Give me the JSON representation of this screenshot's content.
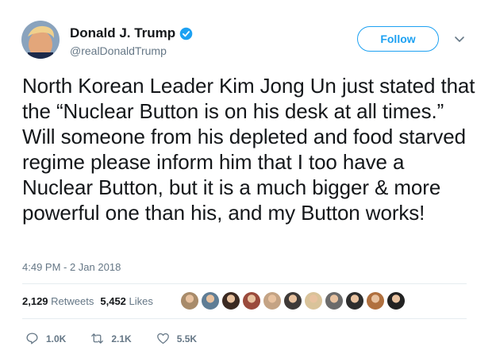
{
  "author": {
    "display_name": "Donald J. Trump",
    "handle": "@realDonaldTrump",
    "avatar_icon": "user-avatar",
    "verified_icon": "verified-badge-icon"
  },
  "follow_button": {
    "label": "Follow"
  },
  "menu": {
    "icon": "chevron-down-icon"
  },
  "tweet": {
    "text": "North Korean Leader Kim Jong Un just stated that the “Nuclear Button is on his desk at all times.” Will someone from his depleted and food starved regime please inform him that I too have a Nuclear Button, but it is a much bigger & more powerful one than his, and my Button works!",
    "timestamp": "4:49 PM - 2 Jan 2018"
  },
  "stats": {
    "retweets_count": "2,129",
    "retweets_label": "Retweets",
    "likes_count": "5,452",
    "likes_label": "Likes"
  },
  "likers": [
    {
      "color": "#a88b6a"
    },
    {
      "color": "#5f7d95"
    },
    {
      "color": "#3b2a22"
    },
    {
      "color": "#9a4a3c"
    },
    {
      "color": "#c4a384"
    },
    {
      "color": "#3e3a38"
    },
    {
      "color": "#d9c39a"
    },
    {
      "color": "#6b6b6b"
    },
    {
      "color": "#2d2d2d"
    },
    {
      "color": "#b0703f"
    },
    {
      "color": "#222222"
    }
  ],
  "actions": {
    "reply_count": "1.0K",
    "retweet_count": "2.1K",
    "like_count": "5.5K"
  },
  "colors": {
    "accent": "#1da1f2",
    "text": "#14171a",
    "muted": "#657786",
    "divider": "#e6ecf0"
  }
}
